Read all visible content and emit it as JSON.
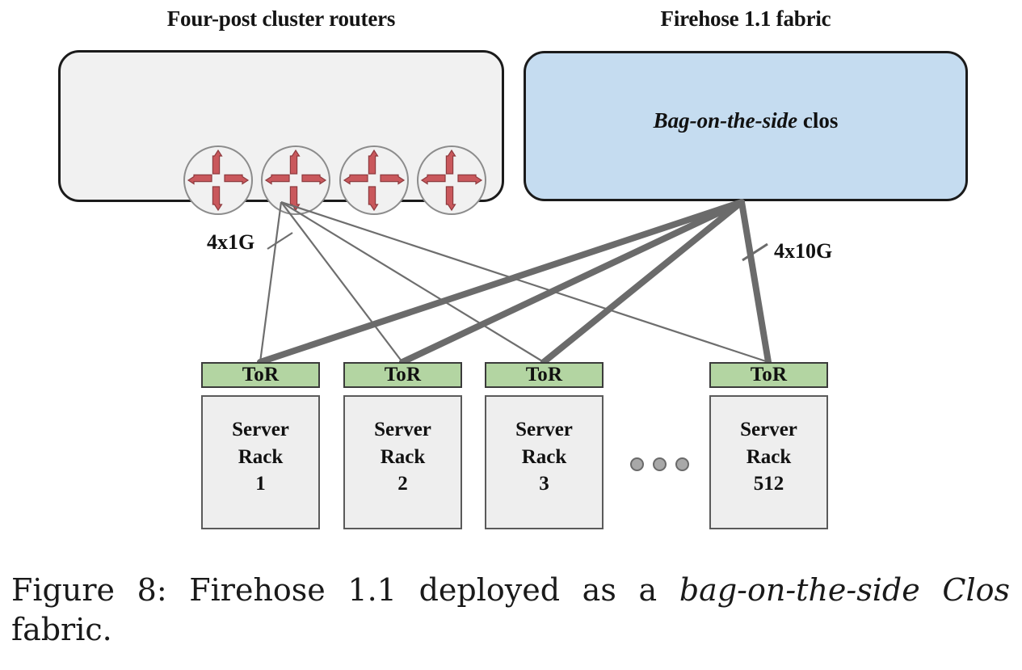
{
  "figure": {
    "groups": {
      "routers": {
        "title": "Four-post cluster routers",
        "router_count": 4,
        "router_icon": "router-cross-arrows-icon"
      },
      "fabric": {
        "title": "Firehose 1.1 fabric",
        "label_italic": "Bag-on-the-side",
        "label_rest": " clos",
        "fill_color": "#c5dcf0"
      }
    },
    "links": {
      "legacy_label": "4x1G",
      "fabric_label": "4x10G"
    },
    "racks": [
      {
        "tor": "ToR",
        "line1": "Server",
        "line2": "Rack",
        "line3": "1"
      },
      {
        "tor": "ToR",
        "line1": "Server",
        "line2": "Rack",
        "line3": "2"
      },
      {
        "tor": "ToR",
        "line1": "Server",
        "line2": "Rack",
        "line3": "3"
      },
      {
        "tor": "ToR",
        "line1": "Server",
        "line2": "Rack",
        "line3": "512"
      }
    ],
    "ellipsis_dot_count": 3,
    "caption": {
      "prefix": "Figure 8:  Firehose 1.1 deployed as a ",
      "italic": "bag-on-the-side Clos",
      "suffix": " fabric."
    },
    "colors": {
      "tor_green": "#b3d5a2",
      "rack_gray": "#eeeeee",
      "router_panel_gray": "#f1f1f1",
      "fabric_blue": "#c5dcf0",
      "arrow_red": "#c9585c",
      "thin_link": "#6e6e6e",
      "thick_link": "#6b6b6b"
    }
  }
}
